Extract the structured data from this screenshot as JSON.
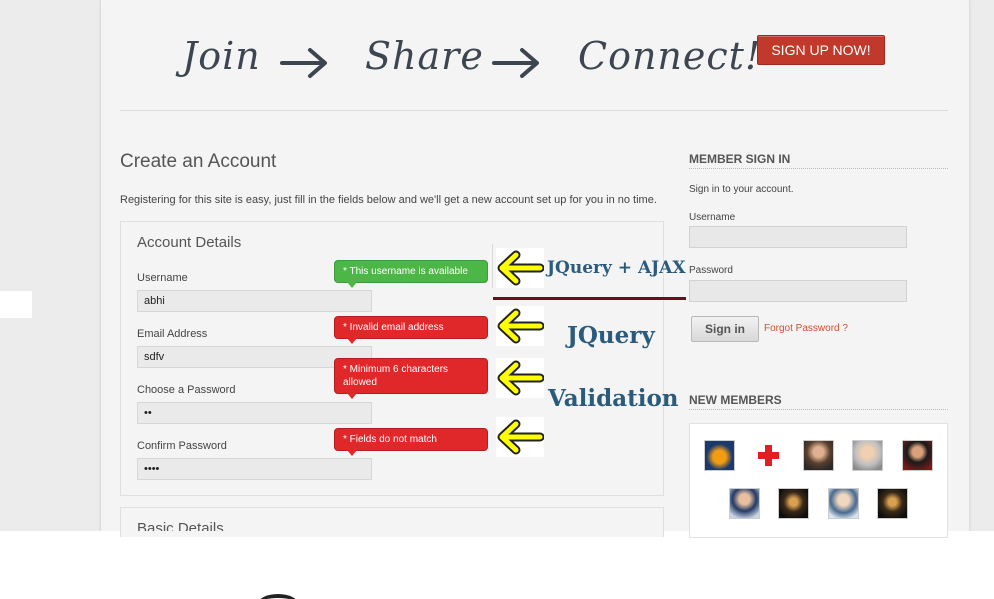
{
  "banner": {
    "word1": "Join",
    "word2": "Share",
    "word3": "Connect!",
    "signup_label": "SIGN UP NOW!"
  },
  "register": {
    "title": "Create an Account",
    "intro": "Registering for this site is easy, just fill in the fields below and we'll get a new account set up for you in no time.",
    "account_details_title": "Account Details",
    "basic_details_title": "Basic Details",
    "fields": [
      {
        "label": "Username",
        "value": "abhi",
        "tooltip": "* This username is available",
        "tooltip_color": "#4cb747"
      },
      {
        "label": "Email Address",
        "value": "sdfv",
        "tooltip": "* Invalid email address",
        "tooltip_color": "#e0282b"
      },
      {
        "label": "Choose a Password",
        "value": "••",
        "tooltip": "* Minimum 6 characters allowed",
        "tooltip_color": "#e0282b"
      },
      {
        "label": "Confirm Password",
        "value": "••••",
        "tooltip": "* Fields do not match",
        "tooltip_color": "#e0282b"
      }
    ]
  },
  "annotations": {
    "a1": "JQuery + AJAX",
    "a2": "JQuery",
    "a3": "Validation"
  },
  "sidebar": {
    "member_signin_title": "MEMBER SIGN IN",
    "signin_text": "Sign in to your account.",
    "username_label": "Username",
    "password_label": "Password",
    "signin_button": "Sign in",
    "forgot_link": "Forgot Password ?",
    "new_members_title": "NEW MEMBERS"
  },
  "colors": {
    "signup_red": "#c0392b",
    "annotation_blue": "#2a5a7c",
    "arrow_yellow": "#ffff00",
    "link_orange": "#d05030"
  }
}
